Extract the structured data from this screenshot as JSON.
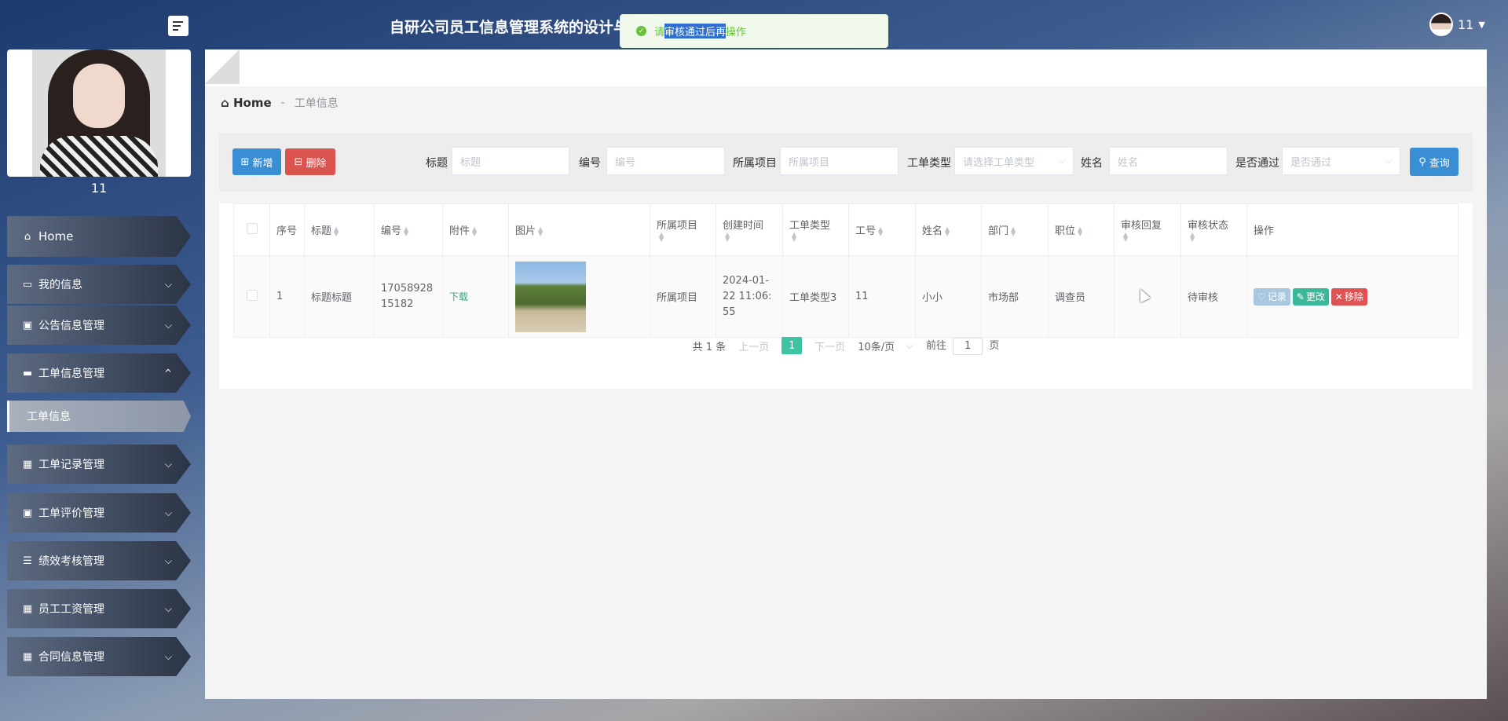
{
  "header": {
    "system_title": "自研公司员工信息管理系统的设计与实",
    "toast_prefix": "请",
    "toast_selected": "审核通过后再",
    "toast_suffix": "操作",
    "username": "11"
  },
  "sidebar": {
    "profile_name": "11",
    "items": [
      {
        "label": "Home"
      },
      {
        "label": "我的信息"
      },
      {
        "label": "公告信息管理"
      },
      {
        "label": "工单信息管理"
      },
      {
        "label": "工单记录管理"
      },
      {
        "label": "工单评价管理"
      },
      {
        "label": "绩效考核管理"
      },
      {
        "label": "员工工资管理"
      },
      {
        "label": "合同信息管理"
      }
    ],
    "sub_item": "工单信息"
  },
  "breadcrumb": {
    "home": "Home",
    "sep": "-",
    "current": "工单信息"
  },
  "search": {
    "add_label": "新增",
    "delete_label": "删除",
    "query_label": "查询",
    "fields": [
      {
        "label": "标题",
        "placeholder": "标题"
      },
      {
        "label": "编号",
        "placeholder": "编号"
      },
      {
        "label": "所属项目",
        "placeholder": "所属项目"
      },
      {
        "label": "工单类型",
        "placeholder": "请选择工单类型"
      },
      {
        "label": "姓名",
        "placeholder": "姓名"
      },
      {
        "label": "是否通过",
        "placeholder": "是否通过"
      }
    ]
  },
  "table": {
    "headers": [
      "序号",
      "标题",
      "编号",
      "附件",
      "图片",
      "所属项目",
      "创建时间",
      "工单类型",
      "工号",
      "姓名",
      "部门",
      "职位",
      "审核回复",
      "审核状态",
      "操作"
    ],
    "rows": [
      {
        "index": "1",
        "title": "标题标题",
        "code": "1705892815182",
        "attachment": "下载",
        "project": "所属项目",
        "created": "2024-01-22 11:06:55",
        "type": "工单类型3",
        "emp_no": "11",
        "name": "小小",
        "dept": "市场部",
        "position": "调查员",
        "reply": "",
        "status": "待审核",
        "ops": {
          "record": "记录",
          "edit": "更改",
          "remove": "移除"
        }
      }
    ]
  },
  "pagination": {
    "total": "共 1 条",
    "prev": "上一页",
    "current": "1",
    "next": "下一页",
    "size": "10条/页",
    "goto": "前往",
    "goto_value": "1",
    "page_unit": "页"
  }
}
